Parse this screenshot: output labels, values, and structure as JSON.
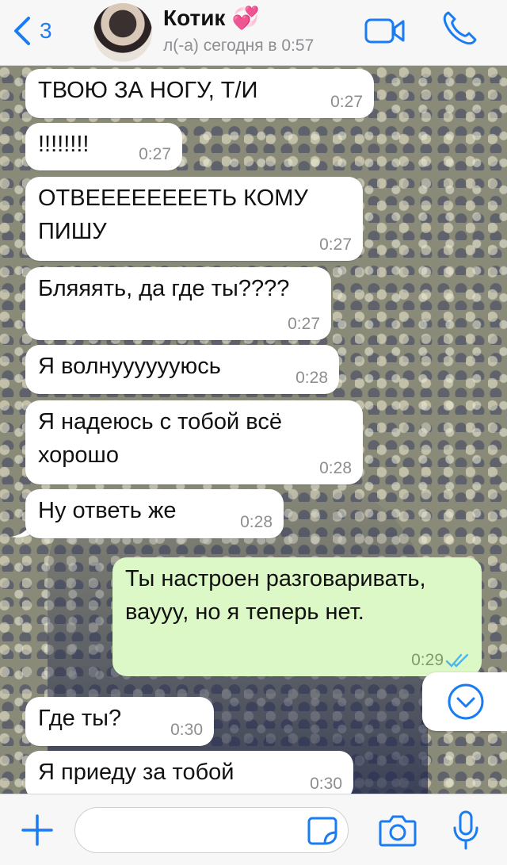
{
  "header": {
    "back_count": "3",
    "contact_name": "Котик",
    "contact_emoji": "💞",
    "status": "л(-а) сегодня в 0:57"
  },
  "messages": [
    {
      "text": "ТВОЮ ЗА НОГУ, Т/И",
      "time": "0:27",
      "direction": "incoming"
    },
    {
      "text": "!!!!!!!!",
      "time": "0:27",
      "direction": "incoming"
    },
    {
      "text": "ОТВЕЕЕЕЕЕЕЕТЬ КОМУ ПИШУ",
      "time": "0:27",
      "direction": "incoming"
    },
    {
      "text": "Бляяять, да где ты????",
      "time": "0:27",
      "direction": "incoming"
    },
    {
      "text": "Я волнууууууюсь",
      "time": "0:28",
      "direction": "incoming"
    },
    {
      "text": "Я надеюсь с тобой всё хорошо",
      "time": "0:28",
      "direction": "incoming"
    },
    {
      "text": "Ну ответь же",
      "time": "0:28",
      "direction": "incoming"
    },
    {
      "text": "Ты настроен разговаривать, вауyy, но я теперь нет.",
      "time": "0:29",
      "direction": "outgoing",
      "status": "read"
    },
    {
      "text": "Где ты?",
      "time": "0:30",
      "direction": "incoming"
    },
    {
      "text": "Я приеду за тобой",
      "time": "0:30",
      "direction": "incoming"
    }
  ],
  "input": {
    "value": "",
    "placeholder": ""
  },
  "colors": {
    "accent": "#1a7cf5",
    "incoming_bubble": "#ffffff",
    "outgoing_bubble": "#dcf8c6",
    "read_ticks": "#4fb6ec"
  },
  "icons": {
    "back": "chevron-left-icon",
    "video": "video-camera-icon",
    "call": "phone-icon",
    "scroll": "chevron-down-circle-icon",
    "plus": "plus-icon",
    "sticker": "sticker-icon",
    "camera": "camera-icon",
    "mic": "microphone-icon"
  }
}
